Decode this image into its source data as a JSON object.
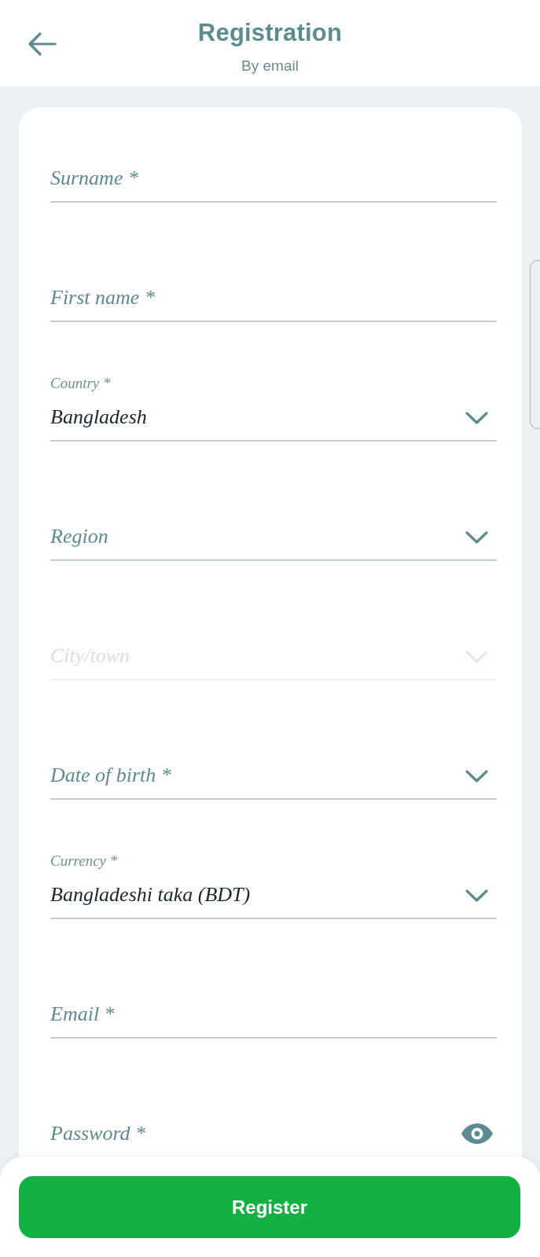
{
  "header": {
    "title": "Registration",
    "subtitle": "By email"
  },
  "form": {
    "fields": [
      {
        "kind": "text",
        "label": "Surname *",
        "disabled": false
      },
      {
        "kind": "text",
        "label": "First name *",
        "disabled": false
      },
      {
        "kind": "select",
        "label": "Country *",
        "value": "Bangladesh",
        "disabled": false
      },
      {
        "kind": "select",
        "label": "Region",
        "disabled": false
      },
      {
        "kind": "select",
        "label": "City/town",
        "disabled": true
      },
      {
        "kind": "select",
        "label": "Date of birth *",
        "disabled": false
      },
      {
        "kind": "select",
        "label": "Currency *",
        "value": "Bangladeshi taka (BDT)",
        "disabled": false
      },
      {
        "kind": "text",
        "label": "Email *",
        "disabled": false
      },
      {
        "kind": "password",
        "label": "Password *",
        "disabled": false
      }
    ]
  },
  "register_button": {
    "label": "Register"
  }
}
